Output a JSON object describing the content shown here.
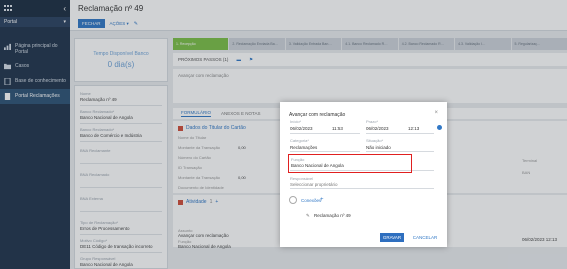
{
  "sidebar": {
    "portal_label": "Portal",
    "items": [
      {
        "label": "Página principal do Portal",
        "icon": "bar-chart-icon"
      },
      {
        "label": "Casos",
        "icon": "folder-icon"
      },
      {
        "label": "Base de conhecimento",
        "icon": "book-icon"
      },
      {
        "label": "Portal Reclamações",
        "icon": "document-icon"
      }
    ]
  },
  "header": {
    "title": "Reclamação nº 49"
  },
  "toolbar": {
    "close_label": "FECHAR",
    "actions_label": "AÇÕES ▾"
  },
  "left_panel": {
    "sla_title": "Tempo Disponível Banco",
    "sla_value": "0 dia(s)",
    "fields": [
      {
        "label": "Nome",
        "value": "Reclamação nº 49"
      },
      {
        "label": "Banco Reclamado*",
        "value": "Banco Nacional de Angola"
      },
      {
        "label": "Banco Reclamado*",
        "value": "Banco de Comércio e Indústria"
      },
      {
        "label": "BNA Reclamante",
        "value": ""
      },
      {
        "label": "BNA Reclamado",
        "value": ""
      },
      {
        "label": "BNA Externa",
        "value": ""
      },
      {
        "label": "Tipo de Reclamação*",
        "value": "Erros de Processamento"
      },
      {
        "label": "Motivo Código*",
        "value": "DE11 Código de transação incorreto"
      },
      {
        "label": "Grupo Responsável",
        "value": "Banco Nacional de Angola"
      }
    ]
  },
  "stages": [
    "1. Recepção",
    "2. Reclamação Enviada Ba…",
    "3. Validação Entrada Ban…",
    "4.1. Banco Reclamado R…",
    "4.2. Banco Reclamado R…",
    "4.3. Validação I…",
    "5. Regularizaç…"
  ],
  "next_steps": {
    "label": "PRÓXIMOS PASSOS (1)",
    "post_item": "Avançar com reclamação"
  },
  "tabs": [
    "FORMULÁRIO",
    "ANEXOS E NOTAS"
  ],
  "section_card": {
    "title": "Dados do Titular do Cartão",
    "rows": [
      {
        "label": "Nome do Titular",
        "value": ""
      },
      {
        "label": "Montante da Transação",
        "value": "0,00"
      },
      {
        "label": "Número do Cartão",
        "value": ""
      },
      {
        "label": "ID Transação",
        "value": ""
      },
      {
        "label": "Montante da Transação",
        "value": "0,00"
      },
      {
        "label": "Documento de Identidade",
        "value": ""
      }
    ]
  },
  "activity_section": {
    "title": "Atividade",
    "count": "1"
  },
  "bg_activity": {
    "assunto_label": "Assunto",
    "assunto_value": "Avançar com reclamação",
    "funcao_label": "Função",
    "funcao_value": "Banco Nacional de Angola",
    "date_value": "06/02/2023 12:13",
    "right_labels": [
      "Terminal",
      "BAN"
    ]
  },
  "modal": {
    "title": "Avançar com reclamação",
    "inicio_label": "Início*",
    "inicio_date": "06/02/2023",
    "inicio_time": "11:53",
    "prazo_label": "Prazo*",
    "prazo_date": "06/02/2023",
    "prazo_time": "12:13",
    "categoria_label": "Categoria*",
    "categoria_value": "Reclamações",
    "situacao_label": "Situação*",
    "situacao_value": "Não iniciado",
    "funcao_label": "Função",
    "funcao_value": "Banco Nacional de Angola",
    "responsavel_label": "Responsável",
    "responsavel_value": "Seleccionar proprietário",
    "conexoes_label": "Conexões",
    "conexoes_add": "+",
    "connection_item": "Reclamação nº 49",
    "save_label": "GRAVAR",
    "cancel_label": "CANCELAR"
  }
}
